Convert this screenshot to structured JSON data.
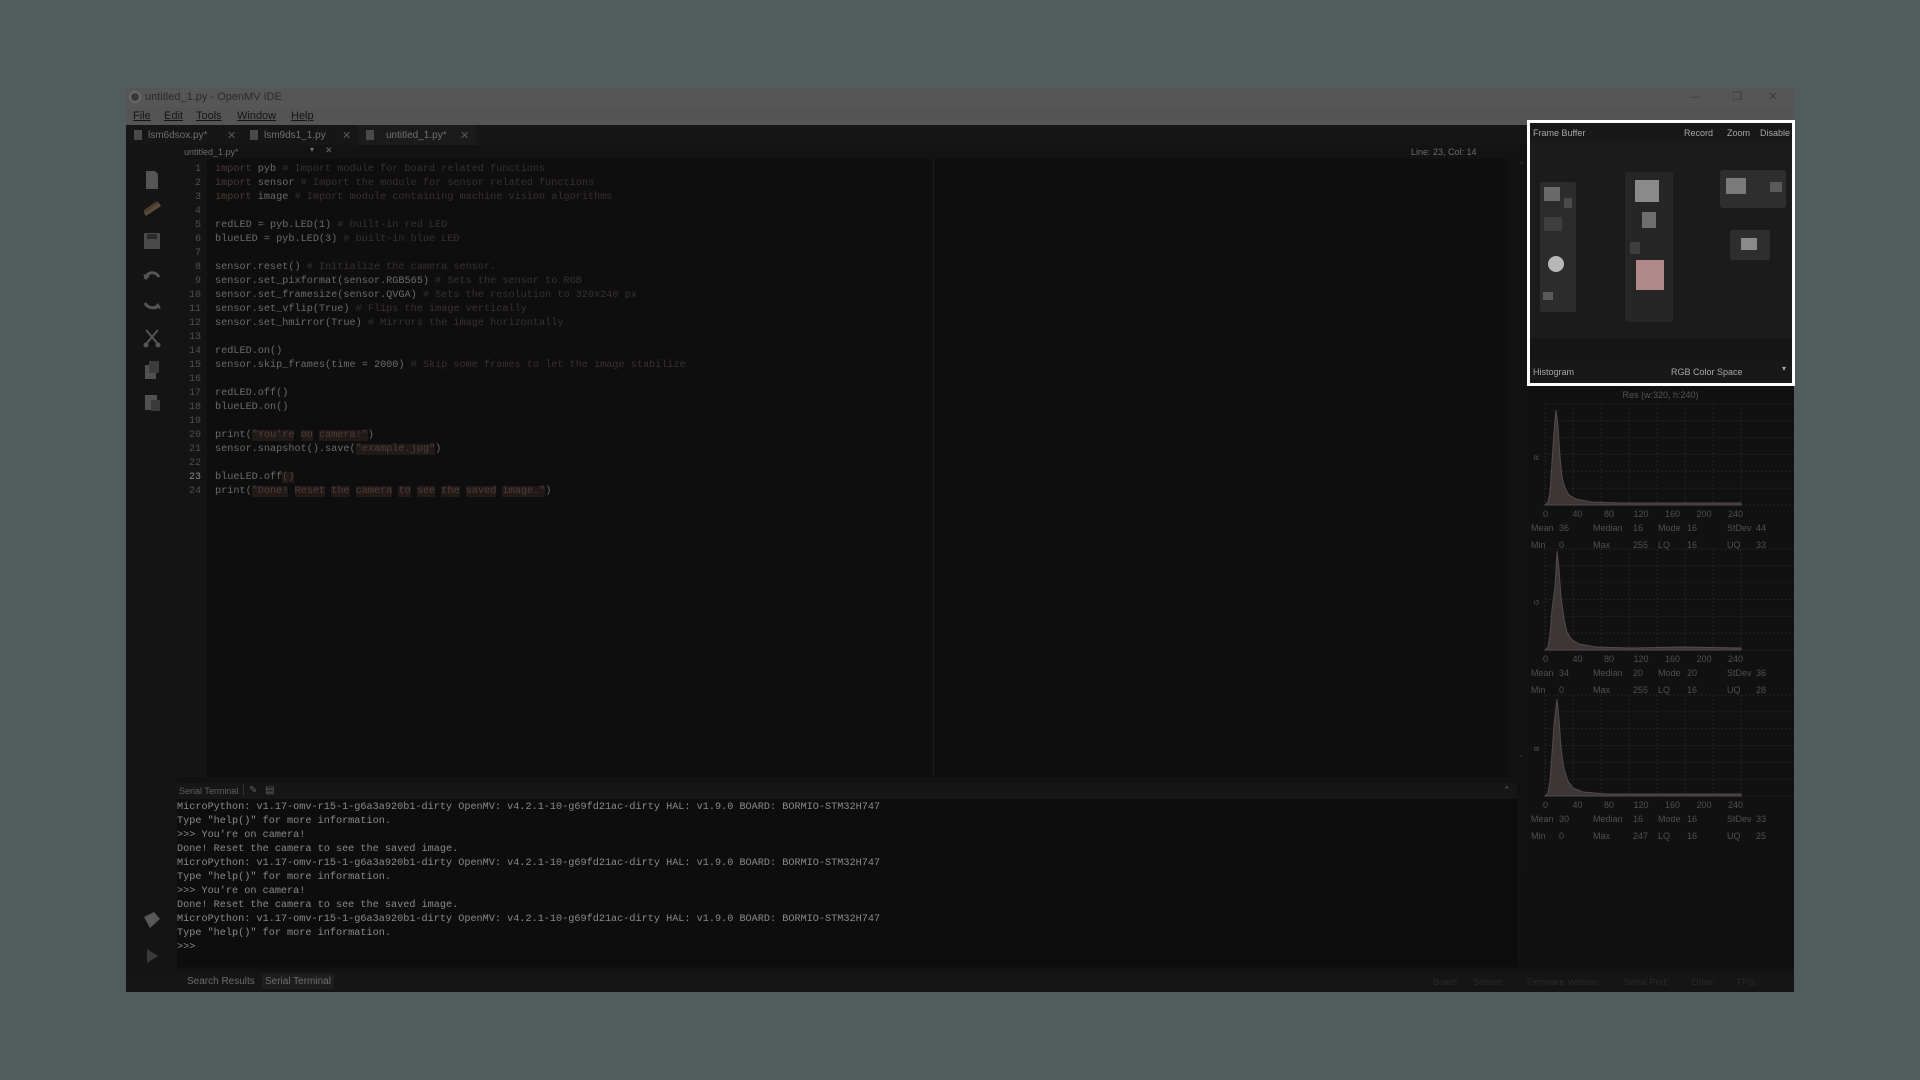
{
  "window": {
    "title": "untitled_1.py - OpenMV IDE"
  },
  "menu": [
    "File",
    "Edit",
    "Tools",
    "Window",
    "Help"
  ],
  "tabs": [
    {
      "label": "lsm6dsox.py*"
    },
    {
      "label": "lsm9ds1_1.py"
    },
    {
      "label": "untitled_1.py*"
    }
  ],
  "editor": {
    "document": "untitled_1.py*",
    "position": "Line: 23, Col: 14",
    "line_numbers": [
      "1",
      "2",
      "3",
      "4",
      "5",
      "6",
      "7",
      "8",
      "9",
      "10",
      "11",
      "12",
      "13",
      "14",
      "15",
      "16",
      "17",
      "18",
      "19",
      "20",
      "21",
      "22",
      "23",
      "24"
    ],
    "code": [
      [
        {
          "c": "kw",
          "t": "import"
        },
        {
          "t": " pyb "
        },
        {
          "c": "cm",
          "t": "# Import module for board related functions"
        }
      ],
      [
        {
          "c": "kw",
          "t": "import"
        },
        {
          "t": " sensor "
        },
        {
          "c": "cm",
          "t": "# Import the module for sensor related functions"
        }
      ],
      [
        {
          "c": "kw",
          "t": "import"
        },
        {
          "t": " image "
        },
        {
          "c": "cm",
          "t": "# Import module containing machine vision algorithms"
        }
      ],
      [],
      [
        {
          "t": "redLED = pyb.LED(1) "
        },
        {
          "c": "cm",
          "t": "# built-in red LED"
        }
      ],
      [
        {
          "t": "blueLED = pyb.LED(3) "
        },
        {
          "c": "cm",
          "t": "# built-in blue LED"
        }
      ],
      [],
      [
        {
          "t": "sensor.reset() "
        },
        {
          "c": "cm",
          "t": "# Initialize the camera sensor."
        }
      ],
      [
        {
          "t": "sensor.set_pixformat(sensor.RGB565) "
        },
        {
          "c": "cm",
          "t": "# Sets the sensor to RGB"
        }
      ],
      [
        {
          "t": "sensor.set_framesize(sensor.QVGA) "
        },
        {
          "c": "cm",
          "t": "# Sets the resolution to 320x240 px"
        }
      ],
      [
        {
          "t": "sensor.set_vflip(True) "
        },
        {
          "c": "cm",
          "t": "# Flips the image vertically"
        }
      ],
      [
        {
          "t": "sensor.set_hmirror(True) "
        },
        {
          "c": "cm",
          "t": "# Mirrors the image horizontally"
        }
      ],
      [],
      [
        {
          "t": "redLED.on()"
        }
      ],
      [
        {
          "t": "sensor.skip_frames(time = 2000) "
        },
        {
          "c": "cm",
          "t": "# Skip some frames to let the image stabilize"
        }
      ],
      [],
      [
        {
          "t": "redLED.off()"
        }
      ],
      [
        {
          "t": "blueLED.on()"
        }
      ],
      [],
      [
        {
          "t": "print("
        },
        {
          "c": "st",
          "t": "\"You're"
        },
        {
          "t": " "
        },
        {
          "c": "st",
          "t": "on"
        },
        {
          "t": " "
        },
        {
          "c": "st",
          "t": "camera!\""
        },
        {
          "t": ")"
        }
      ],
      [
        {
          "t": "sensor.snapshot().save("
        },
        {
          "c": "st",
          "t": "\"example.jpg\""
        },
        {
          "t": ")"
        }
      ],
      [],
      [
        {
          "t": "blueLED.off"
        },
        {
          "c": "st",
          "t": "()"
        }
      ],
      [
        {
          "t": "print("
        },
        {
          "c": "st",
          "t": "\"Done!"
        },
        {
          "t": " "
        },
        {
          "c": "st",
          "t": "Reset"
        },
        {
          "t": " "
        },
        {
          "c": "st",
          "t": "the"
        },
        {
          "t": " "
        },
        {
          "c": "st",
          "t": "camera"
        },
        {
          "t": " "
        },
        {
          "c": "st",
          "t": "to"
        },
        {
          "t": " "
        },
        {
          "c": "st",
          "t": "see"
        },
        {
          "t": " "
        },
        {
          "c": "st",
          "t": "the"
        },
        {
          "t": " "
        },
        {
          "c": "st",
          "t": "saved"
        },
        {
          "t": " "
        },
        {
          "c": "st",
          "t": "image.\""
        },
        {
          "t": ")"
        }
      ]
    ]
  },
  "terminal": {
    "title": "Serial Terminal",
    "lines": [
      "MicroPython: v1.17-omv-r15-1-g6a3a920b1-dirty OpenMV: v4.2.1-10-g69fd21ac-dirty HAL: v1.9.0 BOARD: BORMIO-STM32H747",
      "Type \"help()\" for more information.",
      ">>> You're on camera!",
      "Done! Reset the camera to see the saved image.",
      "MicroPython: v1.17-omv-r15-1-g6a3a920b1-dirty OpenMV: v4.2.1-10-g69fd21ac-dirty HAL: v1.9.0 BOARD: BORMIO-STM32H747",
      "Type \"help()\" for more information.",
      ">>> You're on camera!",
      "Done! Reset the camera to see the saved image.",
      "MicroPython: v1.17-omv-r15-1-g6a3a920b1-dirty OpenMV: v4.2.1-10-g69fd21ac-dirty HAL: v1.9.0 BOARD: BORMIO-STM32H747",
      "Type \"help()\" for more information.",
      ">>>"
    ]
  },
  "status": {
    "tabs": [
      "Search Results",
      "Serial Terminal"
    ],
    "right": [
      "Board:",
      "Sensor:",
      "Firmware Version:",
      "Serial Port:",
      "Drive:",
      "FPS:"
    ]
  },
  "framebuffer": {
    "title": "Frame Buffer",
    "actions": [
      "Record",
      "Zoom",
      "Disable"
    ],
    "histogram_label": "Histogram",
    "color_space": "RGB Color Space",
    "resolution": "Res (w:320, h:240)"
  },
  "histograms": [
    {
      "channel": "R",
      "x_ticks": [
        "0",
        "40",
        "80",
        "120",
        "160",
        "200",
        "240"
      ],
      "stats_row1": [
        [
          "Mean",
          "36"
        ],
        [
          "Median",
          "16"
        ],
        [
          "Mode",
          "16"
        ],
        [
          "StDev",
          "44"
        ]
      ],
      "stats_row2": [
        [
          "Min",
          "0"
        ],
        [
          "Max",
          "255"
        ],
        [
          "LQ",
          "16"
        ],
        [
          "UQ",
          "33"
        ]
      ]
    },
    {
      "channel": "G",
      "x_ticks": [
        "0",
        "40",
        "80",
        "120",
        "160",
        "200",
        "240"
      ],
      "stats_row1": [
        [
          "Mean",
          "34"
        ],
        [
          "Median",
          "20"
        ],
        [
          "Mode",
          "20"
        ],
        [
          "StDev",
          "36"
        ]
      ],
      "stats_row2": [
        [
          "Min",
          "0"
        ],
        [
          "Max",
          "255"
        ],
        [
          "LQ",
          "16"
        ],
        [
          "UQ",
          "28"
        ]
      ]
    },
    {
      "channel": "B",
      "x_ticks": [
        "0",
        "40",
        "80",
        "120",
        "160",
        "200",
        "240"
      ],
      "stats_row1": [
        [
          "Mean",
          "30"
        ],
        [
          "Median",
          "16"
        ],
        [
          "Mode",
          "16"
        ],
        [
          "StDev",
          "33"
        ]
      ],
      "stats_row2": [
        [
          "Min",
          "0"
        ],
        [
          "Max",
          "247"
        ],
        [
          "LQ",
          "16"
        ],
        [
          "UQ",
          "25"
        ]
      ]
    }
  ]
}
